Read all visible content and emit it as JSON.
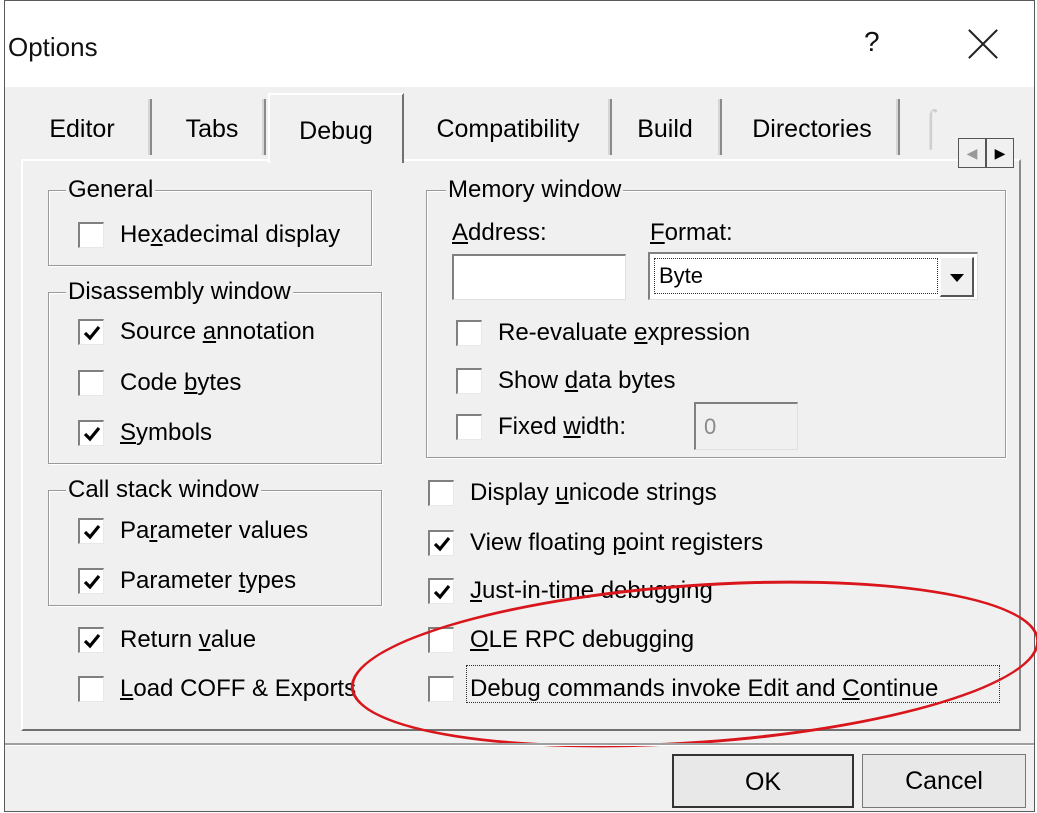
{
  "window": {
    "title": "Options",
    "help": "?",
    "close_icon": "close-icon"
  },
  "tabs": [
    {
      "label": "Editor"
    },
    {
      "label": "Tabs"
    },
    {
      "label": "Debug",
      "active": true
    },
    {
      "label": "Compatibility"
    },
    {
      "label": "Build"
    },
    {
      "label": "Directories"
    }
  ],
  "general": {
    "legend": "General",
    "hexadecimal": {
      "a": "He",
      "k": "x",
      "b": "adecimal display",
      "checked": false
    }
  },
  "disassembly": {
    "legend": "Disassembly window",
    "source_annotation": {
      "a": "Source ",
      "k": "a",
      "b": "nnotation",
      "checked": true
    },
    "code_bytes": {
      "a": "Code ",
      "k": "b",
      "b": "ytes",
      "checked": false
    },
    "symbols": {
      "a": "",
      "k": "S",
      "b": "ymbols",
      "checked": true
    }
  },
  "callstack": {
    "legend": "Call stack window",
    "parameter_values": {
      "a": "Pa",
      "k": "r",
      "b": "ameter values",
      "checked": true
    },
    "parameter_types": {
      "a": "Parameter ",
      "k": "t",
      "b": "ypes",
      "checked": true
    }
  },
  "return_value": {
    "a": "Return ",
    "k": "v",
    "b": "alue",
    "checked": true
  },
  "load_coff": {
    "a": "",
    "k": "L",
    "b": "oad COFF & Exports",
    "checked": false
  },
  "memory": {
    "legend": "Memory window",
    "address_label": {
      "a": "",
      "k": "A",
      "b": "ddress:"
    },
    "address_value": "",
    "format_label": {
      "a": "",
      "k": "F",
      "b": "ormat:"
    },
    "format_value": "Byte",
    "reevaluate": {
      "a": "Re-evaluate ",
      "k": "e",
      "b": "xpression",
      "checked": false
    },
    "show_data_bytes": {
      "a": "Show ",
      "k": "d",
      "b": "ata bytes",
      "checked": false
    },
    "fixed_width": {
      "a": "Fixed ",
      "k": "w",
      "b": "idth:",
      "checked": false
    },
    "fixed_width_value": "0"
  },
  "display_unicode": {
    "a": "Display ",
    "k": "u",
    "b": "nicode strings",
    "checked": false
  },
  "view_floating": {
    "a": "View floating ",
    "k": "p",
    "b": "oint registers",
    "checked": true
  },
  "just_in_time": {
    "a": "",
    "k": "J",
    "b": "ust-in-time debugging",
    "checked": true
  },
  "ole_rpc": {
    "a": "",
    "k": "O",
    "b": "LE RPC debugging",
    "checked": false
  },
  "debug_commands": {
    "a": "Debug commands invoke Edit and ",
    "k": "C",
    "b": "ontinue",
    "checked": false
  },
  "buttons": {
    "ok": "OK",
    "cancel": "Cancel"
  },
  "colors": {
    "annotation_ellipse": "#d8161b",
    "dialog_bg": "#f0f0f0"
  }
}
